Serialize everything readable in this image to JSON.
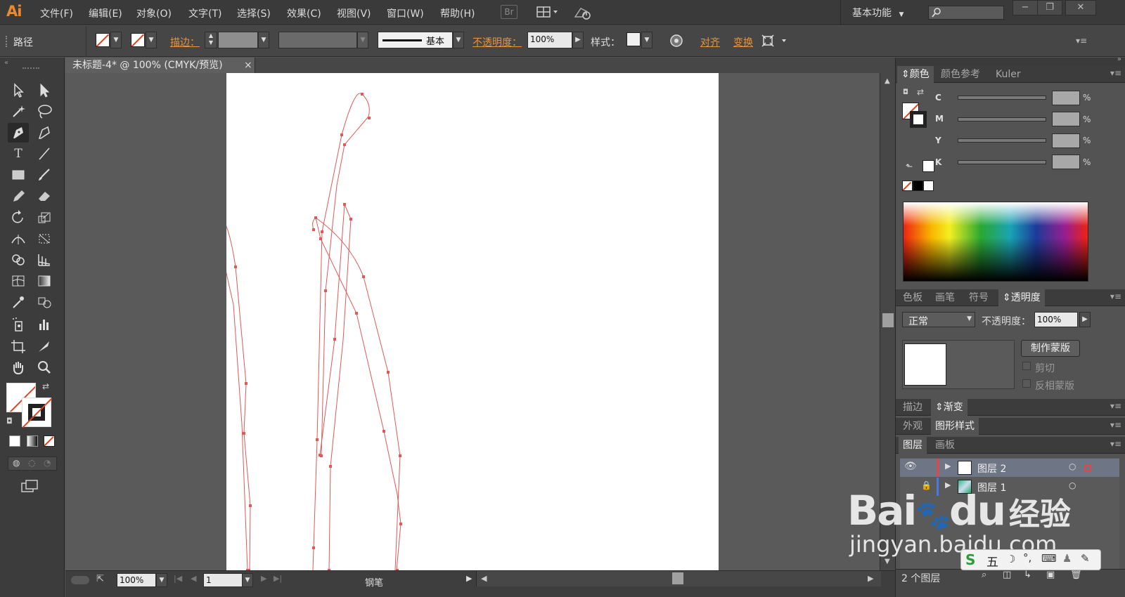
{
  "app": {
    "logo": "Ai",
    "menus": [
      "文件(F)",
      "编辑(E)",
      "对象(O)",
      "文字(T)",
      "选择(S)",
      "效果(C)",
      "视图(V)",
      "窗口(W)",
      "帮助(H)"
    ],
    "bridge": "Br",
    "workspace": "基本功能",
    "window_controls": [
      "−",
      "❐",
      "✕"
    ]
  },
  "control_bar": {
    "selection_label": "路径",
    "stroke_label": "描边",
    "stroke_profile": "基本",
    "opacity_label": "不透明度",
    "opacity_value": "100%",
    "style_label": "样式",
    "align_label": "对齐",
    "transform_label": "变换"
  },
  "document": {
    "tab_title": "未标题-4* @ 100% (CMYK/预览)",
    "tab_close": "×"
  },
  "status_bar": {
    "zoom": "100%",
    "artboard_number": "1",
    "current_tool": "钢笔"
  },
  "panels": {
    "color_group": {
      "tabs": [
        "颜色",
        "颜色参考",
        "Kuler"
      ],
      "channels": [
        "C",
        "M",
        "Y",
        "K"
      ],
      "percent": "%"
    },
    "transparency_group": {
      "tabs": [
        "色板",
        "画笔",
        "符号",
        "透明度"
      ],
      "blend_mode": "正常",
      "opacity_label": "不透明度：",
      "opacity_value": "100%",
      "make_mask_button": "制作蒙版",
      "clip_label": "剪切",
      "invert_mask_label": "反相蒙版"
    },
    "stroke_group": {
      "tabs": [
        "描边",
        "渐变"
      ]
    },
    "appearance_group": {
      "tabs": [
        "外观",
        "图形样式"
      ]
    },
    "layers_group": {
      "tabs": [
        "图层",
        "画板"
      ],
      "layers": [
        {
          "name": "图层 2",
          "color": "#e04848"
        },
        {
          "name": "图层 1",
          "color": "#4a78e0"
        }
      ],
      "count_label": "2 个图层"
    }
  },
  "watermark": {
    "brand": "Bai",
    "brand2": "du",
    "suffix": "经验",
    "url": "jingyan.baidu.com"
  },
  "ime": {
    "label": "五"
  },
  "colors": {
    "accent_orange": "#e7943a",
    "path_red": "#e05858",
    "artboard": "#ffffff"
  }
}
